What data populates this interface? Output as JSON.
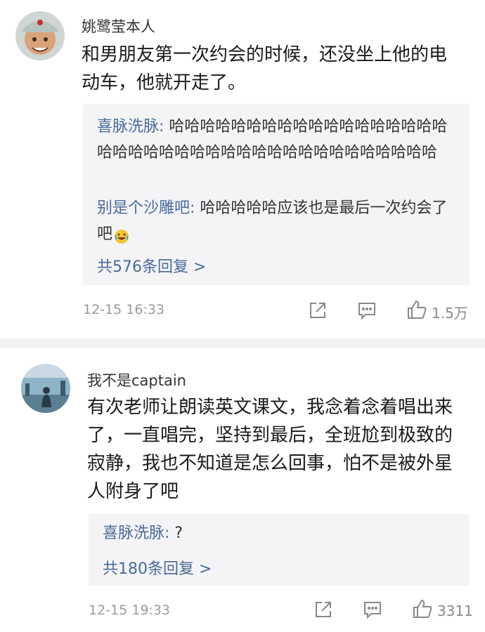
{
  "comments": [
    {
      "username": "姚鹭莹本人",
      "text": "和男朋友第一次约会的时候，还没坐上他的电动车，他就开走了。",
      "replies": [
        {
          "author": "喜脉洗脉:",
          "text": " 哈哈哈哈哈哈哈哈哈哈哈哈哈哈哈哈哈哈哈哈哈哈哈哈哈哈哈哈哈哈哈哈哈哈哈哈哈哈哈哈"
        },
        {
          "author": "别是个沙雕吧:",
          "text": " 哈哈哈哈哈应该也是最后一次约会了吧",
          "emoji": "laugh-cry-emoji"
        }
      ],
      "reply_count": "共576条回复 >",
      "time": "12-15 16:33",
      "likes": "1.5万"
    },
    {
      "username": "我不是captain",
      "text": "有次老师让朗读英文课文，我念着念着唱出来了，一直唱完，坚持到最后，全班尬到极致的寂静，我也不知道是怎么回事，怕不是被外星人附身了吧",
      "replies": [
        {
          "author": "喜脉洗脉:",
          "text": " ?"
        }
      ],
      "reply_count": "共180条回复 >",
      "time": "12-15 19:33",
      "likes": "3311"
    }
  ],
  "icons": {
    "share": "share-icon",
    "comment": "comment-icon",
    "like": "thumbs-up-icon"
  },
  "colors": {
    "link": "#4a6a9a",
    "reply_bg": "#f4f4f6",
    "meta": "#9a9a9a"
  }
}
